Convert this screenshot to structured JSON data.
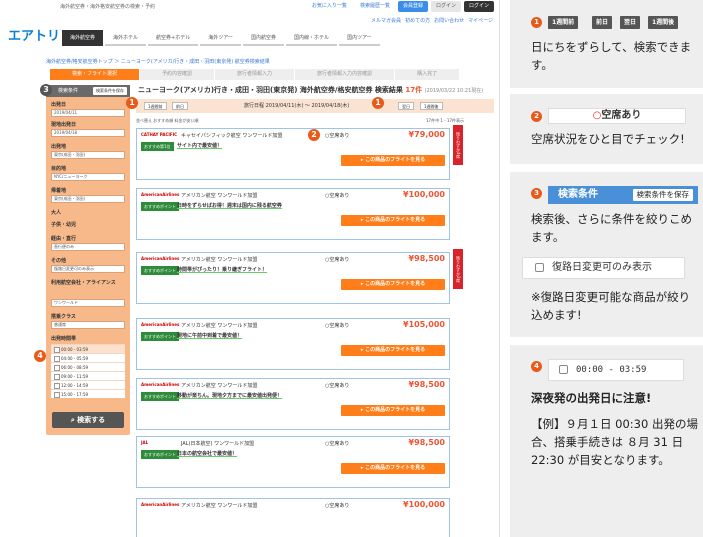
{
  "site": {
    "logo": "エアトリ",
    "tagline": "海外航空券・海外格安航空券の検索・予約",
    "links": [
      "お気に入り一覧",
      "検索履歴一覧",
      "会員登録",
      "ログイン",
      "ログイン"
    ],
    "nav": [
      "海外航空券",
      "海外ホテル",
      "航空券+ホテル",
      "海外ツアー",
      "国内航空券",
      "国内線・ホテル",
      "国内ツアー"
    ],
    "nav_right": [
      "メルマガ会員",
      "初めての方",
      "お問い合わせ",
      "マイページ",
      "お気に入り",
      "マイページ"
    ],
    "breadcrumb": "海外航空券/格安航空券トップ ＞ ニューヨーク(アメリカ/行き・成田・羽田(東京発) 航空券検索結果"
  },
  "steps": [
    "検索・フライト選択",
    "予約内容確認",
    "旅行者情報入力",
    "旅行者情報入力内容確認",
    "購入完了"
  ],
  "sidebar": {
    "header": "検索条件",
    "save_btn": "検索条件を保存",
    "dep_date_label": "出発日",
    "dep_date": "2019/04/11",
    "ret_date_label": "現地出発日",
    "ret_date": "2019/04/18",
    "from_label": "出発地",
    "from": "東京(成田・羽田)",
    "to_label": "目的地",
    "to": "NYC/ニューヨーク",
    "return_label": "帰着地",
    "return": "東京(成田・羽田)",
    "pax_adult": "大人",
    "pax_child": "子供・幼児",
    "stops_label": "経由・直行",
    "stops": "直行便のみ",
    "other_label": "その他",
    "other_opt": "復路日変更可のみ表示",
    "alliance_label": "利用航空会社・アライアンス",
    "alliance": "ワンワールド",
    "seat_label": "搭乗クラス",
    "seat": "普通席",
    "time_label": "出発時間帯",
    "times": [
      "00:00 - 03:59",
      "04:00 - 05:59",
      "06:00 - 08:59",
      "09:00 - 11:59",
      "12:00 - 14:59",
      "15:00 - 17:59"
    ],
    "search_btn": "検索する"
  },
  "main": {
    "title": "ニューヨーク(アメリカ)行き・成田・羽田(東京発) 海外航空券/格安航空券 検索結果",
    "count": "17件",
    "timestamp": "(2019/03/22 10:21現在)",
    "prev_week": "1週間前",
    "prev_day": "前日",
    "next_day": "翌日",
    "next_week": "1週間後",
    "date_label": "旅行日程 2019/04/11(木) 〜 2019/04/18(木)",
    "sort": "並べ替え おすすめ順 料金が安い順",
    "range": "17件中 1 - 17件表示",
    "cards": [
      {
        "airline": "CATHAY PACIFIC",
        "name": "キャセイパシフィック航空 ワンワールド加盟",
        "seat": "空席あり",
        "price": "79,000",
        "point": "おすすめ第1位",
        "ptext": "サイト内で最安値！",
        "ribbon": "残りわずか4席"
      },
      {
        "airline": "AmericanAirlines",
        "name": "アメリカン航空 ワンワールド加盟",
        "seat": "空席あり",
        "price": "100,000",
        "point": "おすすめポイント",
        "ptext": "日時をずらせばお得！週末は国内に残る航空券",
        "ribbon": ""
      },
      {
        "airline": "AmericanAirlines",
        "name": "アメリカン航空 ワンワールド加盟",
        "seat": "空席あり",
        "price": "98,500",
        "point": "おすすめポイント",
        "ptext": "時間帯がぴったり！乗り継ぎフライト！",
        "ribbon": "残りわずか2席"
      },
      {
        "airline": "AmericanAirlines",
        "name": "アメリカン航空 ワンワールド加盟",
        "seat": "空席あり",
        "price": "105,000",
        "point": "おすすめポイント",
        "ptext": "現地に午前中到着で最安値！",
        "ribbon": ""
      },
      {
        "airline": "AmericanAirlines",
        "name": "アメリカン航空 ワンワールド加盟",
        "seat": "空席あり",
        "price": "98,500",
        "point": "おすすめポイント",
        "ptext": "移動が楽ちん。現地夕方までに最安値出発便！",
        "ribbon": ""
      },
      {
        "airline": "JAL",
        "name": "JAL(日本航空) ワンワールド加盟",
        "seat": "空席あり",
        "price": "98,500",
        "point": "おすすめポイント",
        "ptext": "日本の航空会社で最安値！",
        "ribbon": ""
      },
      {
        "airline": "AmericanAirlines",
        "name": "アメリカン航空 ワンワールド加盟",
        "seat": "空席あり",
        "price": "100,000",
        "point": "",
        "ptext": "",
        "ribbon": ""
      }
    ],
    "go_label": "この商品のフライトを見る",
    "cur": "¥"
  },
  "right": {
    "s1_btns": [
      "1週間前",
      "前日",
      "翌日",
      "1週間後"
    ],
    "s1_text": "日にちをずらして、検索できます。",
    "s2_badge": "空席あり",
    "s2_text": "空席状況をひと目でチェック!",
    "s3_label": "検索条件",
    "s3_btn": "検索条件を保存",
    "s3_text": "検索後、さらに条件を絞りこめます。",
    "s3_check": "復路日変更可のみ表示",
    "s3_note": "※復路日変更可能な商品が絞り込めます!",
    "s4_time": "00:00 - 03:59",
    "s4_title": "深夜発の出発日に注意!",
    "s4_text": "【例】９月１日 00:30 出発の場合、搭乗手続きは ８月 31 日 22:30 が目安となります。"
  },
  "numbers": [
    "1",
    "2",
    "3",
    "4"
  ]
}
